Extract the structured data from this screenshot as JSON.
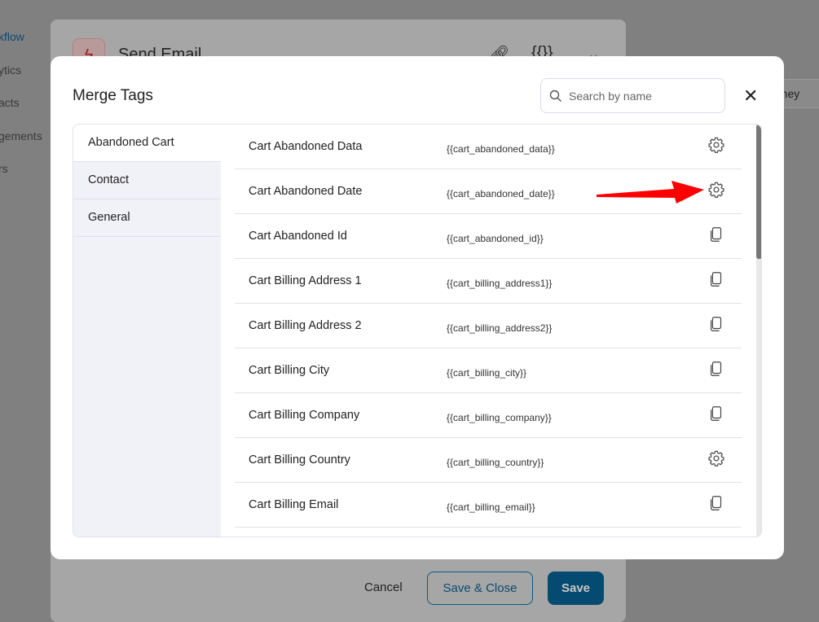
{
  "sidebar": {
    "items": [
      "kflow",
      "ytics",
      "acts",
      "gements",
      "rs"
    ]
  },
  "background_panel": {
    "title": "Send Email",
    "journey_label": "rney",
    "cancel": "Cancel",
    "save_close": "Save & Close",
    "save": "Save"
  },
  "modal": {
    "title": "Merge Tags",
    "search_placeholder": "Search by name",
    "categories": [
      "Abandoned Cart",
      "Contact",
      "General"
    ],
    "selected_category": "Abandoned Cart",
    "rows": [
      {
        "name": "Cart Abandoned Data",
        "tag": "{{cart_abandoned_data}}",
        "icon": "gear-icon"
      },
      {
        "name": "Cart Abandoned Date",
        "tag": "{{cart_abandoned_date}}",
        "icon": "gear-icon"
      },
      {
        "name": "Cart Abandoned Id",
        "tag": "{{cart_abandoned_id}}",
        "icon": "copy-icon"
      },
      {
        "name": "Cart Billing Address 1",
        "tag": "{{cart_billing_address1}}",
        "icon": "copy-icon"
      },
      {
        "name": "Cart Billing Address 2",
        "tag": "{{cart_billing_address2}}",
        "icon": "copy-icon"
      },
      {
        "name": "Cart Billing City",
        "tag": "{{cart_billing_city}}",
        "icon": "copy-icon"
      },
      {
        "name": "Cart Billing Company",
        "tag": "{{cart_billing_company}}",
        "icon": "copy-icon"
      },
      {
        "name": "Cart Billing Country",
        "tag": "{{cart_billing_country}}",
        "icon": "gear-icon"
      },
      {
        "name": "Cart Billing Email",
        "tag": "{{cart_billing_email}}",
        "icon": "copy-icon"
      },
      {
        "name": "",
        "tag": "",
        "icon": ""
      }
    ]
  },
  "colors": {
    "accent": "#054a70",
    "annotation_arrow": "#ff0000"
  }
}
